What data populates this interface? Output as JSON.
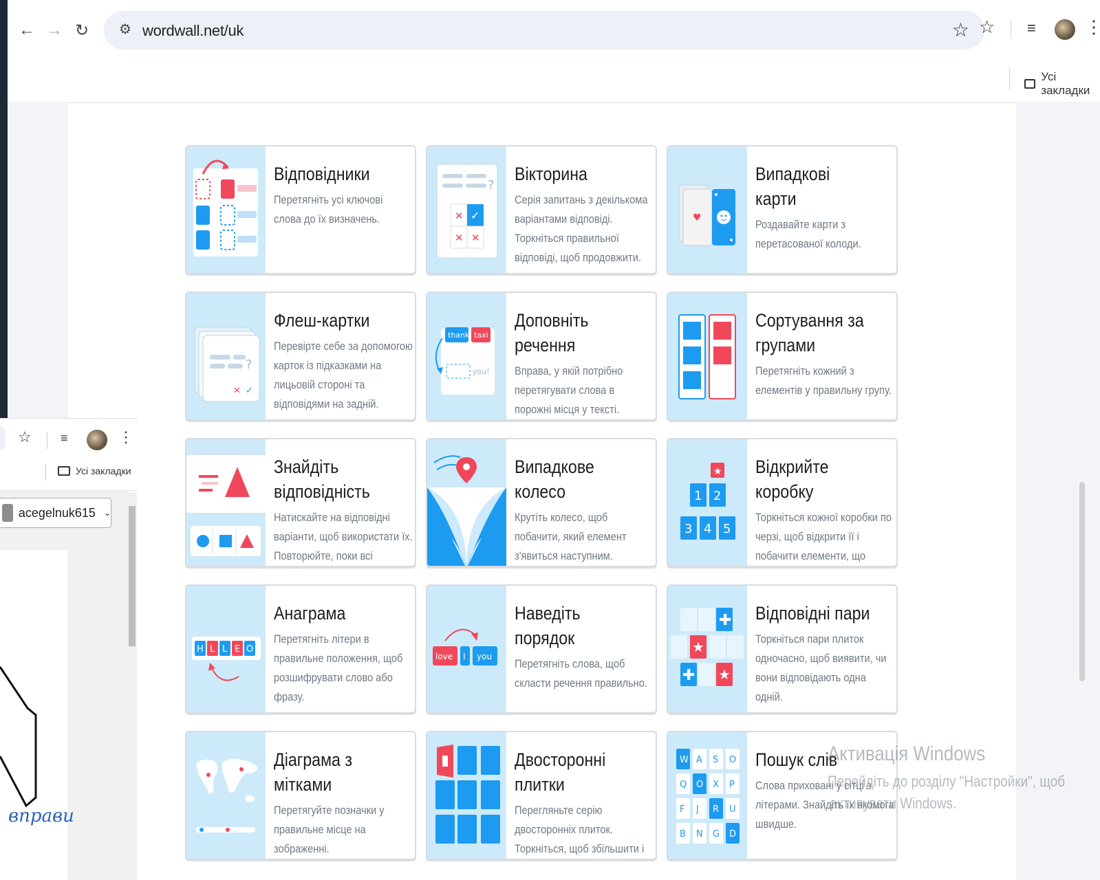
{
  "browser": {
    "url": "wordwall.net/uk",
    "bookmarks_label": "Усі закладки"
  },
  "cards": [
    {
      "title": "Відповідники",
      "desc": "Перетягніть усі ключові слова до їх визначень."
    },
    {
      "title": "Вікторина",
      "desc": "Серія запитань з декількома варіантами відповіді. Торкніться правильної відповіді, щоб продовжити."
    },
    {
      "title": "Випадкові карти",
      "desc": "Роздавайте карти з перетасованої колоди."
    },
    {
      "title": "Флеш-картки",
      "desc": "Перевірте себе за допомогою карток із підказками на лицьовій стороні та відповідями на задній."
    },
    {
      "title": "Доповніть речення",
      "desc": "Вправа, у якій потрібно перетягувати слова в порожні місця у тексті."
    },
    {
      "title": "Сортування за групами",
      "desc": "Перетягніть кожний з елементів у правильну групу."
    },
    {
      "title": "Знайдіть відповідність",
      "desc": "Натискайте на відповідні варіанти, щоб використати їх. Повторюйте, поки всі варіанти"
    },
    {
      "title": "Випадкове колесо",
      "desc": "Крутіть колесо, щоб побачити, який елемент з'явиться наступним."
    },
    {
      "title": "Відкрийте коробку",
      "desc": "Торкніться кожної коробки по черзі, щоб відкрити її і побачити елементи, що знаходяться всередині."
    },
    {
      "title": "Анаграма",
      "desc": "Перетягніть літери в правильне положення, щоб розшифрувати слово або фразу."
    },
    {
      "title": "Наведіть порядок",
      "desc": "Перетягніть слова, щоб скласти речення правильно."
    },
    {
      "title": "Відповідні пари",
      "desc": "Торкніться пари плиток одночасно, щоб виявити, чи вони відповідають одна одній."
    },
    {
      "title": "Діаграма з мітками",
      "desc": "Перетягуйте позначки у правильне місце на зображенні."
    },
    {
      "title": "Двосторонні плитки",
      "desc": "Перегляньте серію двосторонніх плиток. Торкніться, щоб збільшити і проведіть пальцем, щоб"
    },
    {
      "title": "Пошук слів",
      "desc": "Слова приховані у сітці з літерами. Знайдіть їх якомога швидше."
    }
  ],
  "thumb_text": {
    "cloze_a": "thank",
    "cloze_b": "taxi",
    "cloze_c": "you!",
    "anagram": [
      "H",
      "L",
      "L",
      "E",
      "O"
    ],
    "order": [
      "love",
      "I",
      "you"
    ],
    "box_nums": [
      "1",
      "2",
      "3",
      "4",
      "5"
    ],
    "wordsearch": [
      "W",
      "A",
      "S",
      "O",
      "Q",
      "O",
      "X",
      "P",
      "F",
      "J",
      "R",
      "U",
      "B",
      "N",
      "G",
      "D"
    ]
  },
  "popup": {
    "account": "acegelnuk615",
    "bookmarks_label": "Усі закладки",
    "handwriting": "вправи"
  },
  "watermark": {
    "line1": "Активація Windows",
    "line2": "Перейдіть до розділу \"Настройки\", щоб",
    "line3": "активувати Windows."
  },
  "colors": {
    "thumb_bg": "#cdeafa",
    "red": "#f0485a",
    "blue": "#1d9bf0",
    "panel": "#ffffff"
  },
  "icons": [
    "back-arrow-icon",
    "forward-arrow-icon",
    "reload-icon",
    "site-settings-icon",
    "star-icon",
    "extensions-icon",
    "media-icon",
    "menu-icon",
    "folder-icon"
  ]
}
